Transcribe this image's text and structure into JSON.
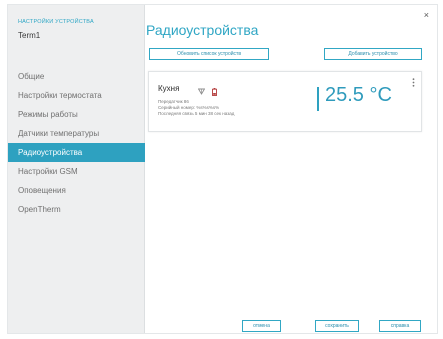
{
  "sidebar": {
    "caption": "НАСТРОЙКИ УСТРОЙСТВА",
    "device_name": "Term1",
    "items": [
      {
        "label": "Общие"
      },
      {
        "label": "Настройки термостата"
      },
      {
        "label": "Режимы работы"
      },
      {
        "label": "Датчики температуры"
      },
      {
        "label": "Радиоустройства",
        "active": true
      },
      {
        "label": "Настройки GSM"
      },
      {
        "label": "Оповещения"
      },
      {
        "label": "OpenTherm"
      }
    ]
  },
  "window": {
    "close_label": "×"
  },
  "main": {
    "title": "Радиоустройства",
    "refresh_label": "Обновить список устройств",
    "add_label": "Добавить устройство"
  },
  "device_card": {
    "name": "Кухня",
    "line1": "Передатчик 86",
    "line2": "Серийный номер: %s%s%s%",
    "line3": "Последняя связь 5 мин 38 сек назад",
    "temperature": "25.5 °C",
    "icons": [
      "signal-icon",
      "battery-icon",
      "kebab-menu-icon"
    ]
  },
  "footer": {
    "cancel_label": "отмена",
    "save_label": "сохранить",
    "help_label": "справка"
  },
  "colors": {
    "accent": "#2ea1c0",
    "sidebar_bg": "#eeeff0",
    "text_muted": "#707070"
  }
}
